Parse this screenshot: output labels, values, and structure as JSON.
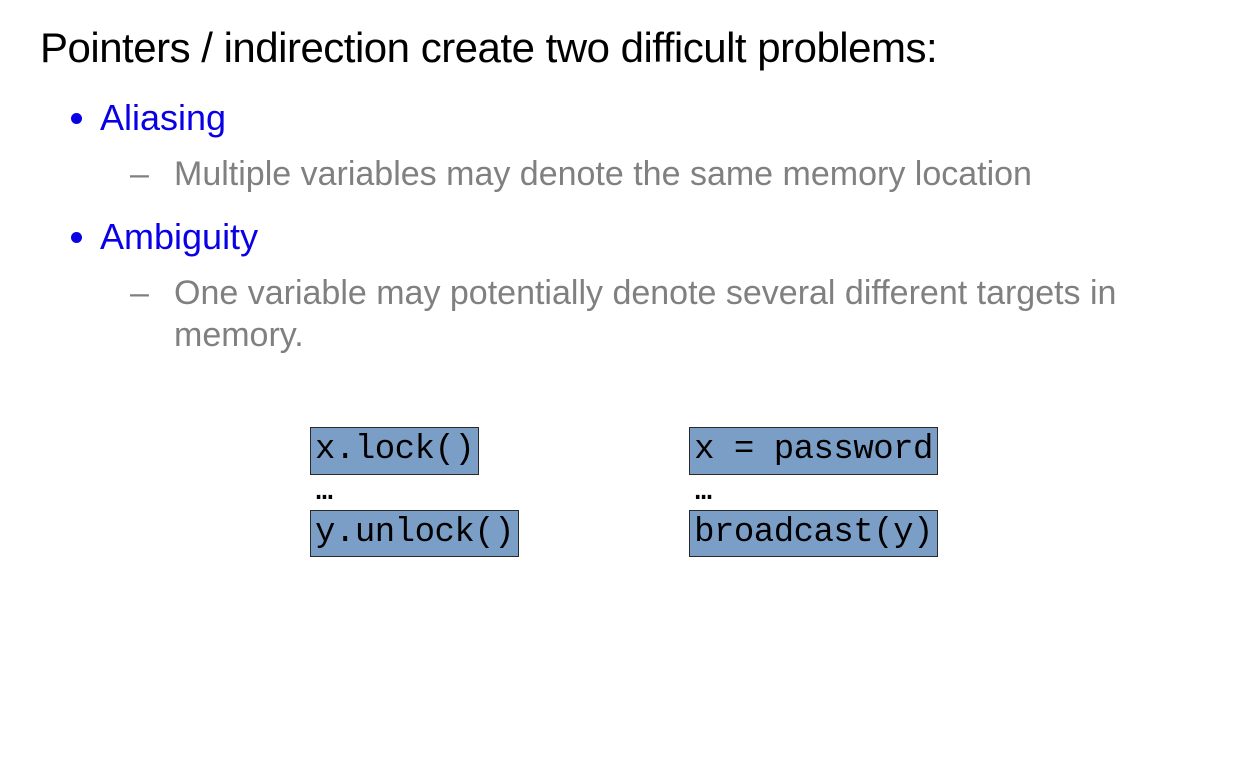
{
  "title": "Pointers / indirection create two  difficult problems:",
  "items": [
    {
      "term": "Aliasing",
      "desc": "Multiple variables may denote the same memory location"
    },
    {
      "term": "Ambiguity",
      "desc": "One variable may potentially denote several different targets in memory."
    }
  ],
  "code_left": {
    "line1": "x.lock()",
    "sep": "…",
    "line2": "y.unlock()"
  },
  "code_right": {
    "line1": "x = password",
    "sep": "…",
    "line2": "broadcast(y)"
  }
}
